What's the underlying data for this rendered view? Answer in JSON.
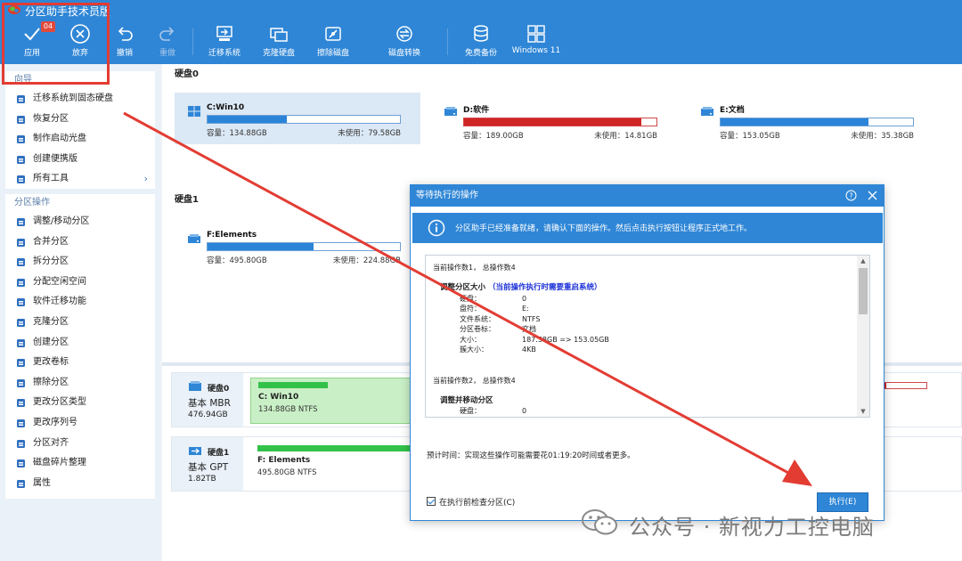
{
  "app": {
    "title": "分区助手技术员版"
  },
  "toolbar": {
    "apply": {
      "label": "应用",
      "badge": "04"
    },
    "discard": {
      "label": "放弃"
    },
    "undo": {
      "label": "撤销"
    },
    "redo": {
      "label": "重做"
    },
    "migrate": {
      "label": "迁移系统"
    },
    "clone_disk": {
      "label": "克隆硬盘"
    },
    "wipe_disk": {
      "label": "擦除磁盘"
    },
    "disk_convert": {
      "label": "磁盘转换"
    },
    "free_backup": {
      "label": "免费备份"
    },
    "windows11": {
      "label": "Windows 11"
    }
  },
  "sidebar": {
    "wizard_title": "向导",
    "wizard_items": [
      {
        "label": "迁移系统到固态硬盘",
        "icon": "migrate-ssd-icon"
      },
      {
        "label": "恢复分区",
        "icon": "restore-partition-icon"
      },
      {
        "label": "制作启动光盘",
        "icon": "boot-disc-icon"
      },
      {
        "label": "创建便携版",
        "icon": "portable-icon"
      },
      {
        "label": "所有工具",
        "icon": "more-icon",
        "chevron": "›"
      }
    ],
    "ops_title": "分区操作",
    "ops_items": [
      {
        "label": "调整/移动分区",
        "icon": "resize-icon"
      },
      {
        "label": "合并分区",
        "icon": "merge-icon"
      },
      {
        "label": "拆分分区",
        "icon": "split-icon"
      },
      {
        "label": "分配空闲空间",
        "icon": "allocate-icon"
      },
      {
        "label": "软件迁移功能",
        "icon": "app-migrate-icon"
      },
      {
        "label": "克隆分区",
        "icon": "clone-partition-icon"
      },
      {
        "label": "创建分区",
        "icon": "create-partition-icon"
      },
      {
        "label": "更改卷标",
        "icon": "label-icon"
      },
      {
        "label": "擦除分区",
        "icon": "wipe-icon"
      },
      {
        "label": "更改分区类型",
        "icon": "id-icon"
      },
      {
        "label": "更改序列号",
        "icon": "serial-icon"
      },
      {
        "label": "分区对齐",
        "icon": "align-icon"
      },
      {
        "label": "磁盘碎片整理",
        "icon": "defrag-icon"
      },
      {
        "label": "属性",
        "icon": "info-icon"
      }
    ]
  },
  "disk0": {
    "title": "硬盘0",
    "partitions": [
      {
        "name": "C:Win10",
        "capacity": "容量：134.88GB",
        "free": "未使用：79.58GB",
        "fill": 0.41,
        "color": "#2b84d8",
        "selected": true
      },
      {
        "name": "D:软件",
        "capacity": "容量：189.00GB",
        "free": "未使用：14.81GB",
        "fill": 0.92,
        "color": "#d02525",
        "selected": false
      },
      {
        "name": "E:文档",
        "capacity": "容量：153.05GB",
        "free": "未使用：35.38GB",
        "fill": 0.77,
        "color": "#2b84d8",
        "selected": false
      }
    ]
  },
  "disk1": {
    "title": "硬盘1",
    "partitions": [
      {
        "name": "F:Elements",
        "capacity": "容量：495.80GB",
        "free": "未使用：224.88GB",
        "fill": 0.55,
        "color": "#2b84d8",
        "selected": false
      }
    ]
  },
  "disk_map": [
    {
      "name": "硬盘0",
      "type": "基本 MBR",
      "size": "476.94GB",
      "part_name": "C: Win10",
      "part_fs": "134.88GB NTFS",
      "selected": true
    },
    {
      "name": "硬盘1",
      "type": "基本 GPT",
      "size": "1.82TB",
      "part_name": "F: Elements",
      "part_fs": "495.80GB NTFS",
      "selected": false
    }
  ],
  "dialog": {
    "title": "等待执行的操作",
    "info": "分区助手已经准备就绪，请确认下面的操作。然后点击执行按钮让程序正式地工作。",
    "log": {
      "op1_count": "当前操作数1， 总操作数4",
      "op1_title": "调整分区大小",
      "op1_note": "（当前操作执行时需要重启系统）",
      "op1_rows": [
        {
          "k": "硬盘：",
          "v": "0"
        },
        {
          "k": "盘符：",
          "v": "E:"
        },
        {
          "k": "文件系统：",
          "v": "NTFS"
        },
        {
          "k": "分区卷标：",
          "v": "文档"
        },
        {
          "k": "大小：",
          "v": "187.38GB => 153.05GB"
        },
        {
          "k": "簇大小：",
          "v": "4KB"
        }
      ],
      "op2_count": "当前操作数2， 总操作数4",
      "op2_title": "调整并移动分区",
      "op2_rows": [
        {
          "k": "硬盘：",
          "v": "0"
        }
      ]
    },
    "estimate": "预计时间：实现这些操作可能需要花01:19:20时间或者更多。",
    "check_label": "在执行前检查分区(C)",
    "check_checked": true,
    "execute_label": "执行(E)"
  },
  "watermark": {
    "text": "公众号 · 新视力工控电脑"
  },
  "colors": {
    "accent": "#2f86d6",
    "annotation": "#e33c33",
    "used_green": "#32c24a"
  }
}
